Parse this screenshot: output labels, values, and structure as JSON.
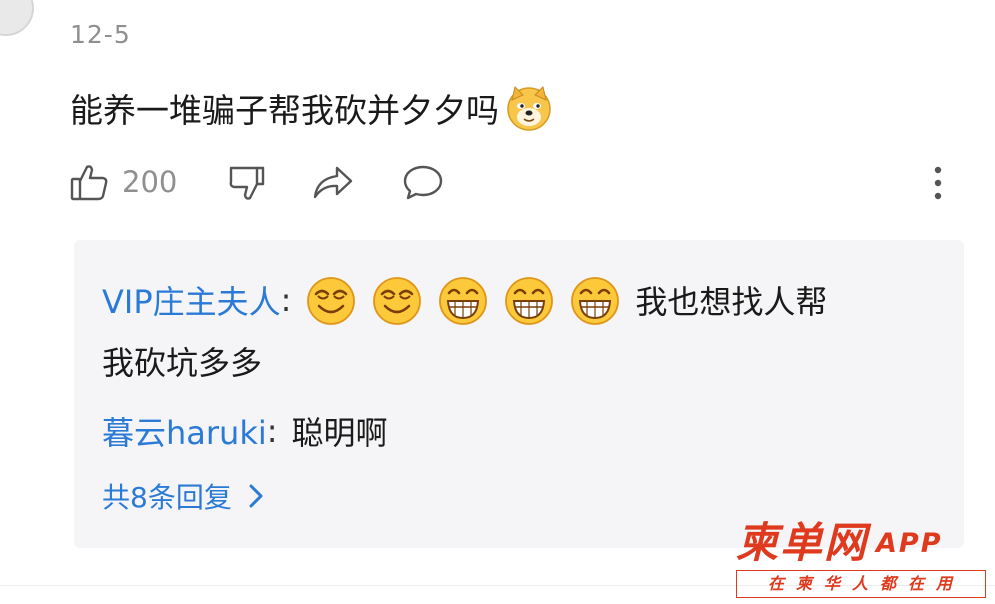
{
  "comment": {
    "date": "12-5",
    "text": "能养一堆骗子帮我砍并夕夕吗",
    "emoji": "doge-emoji"
  },
  "actions": {
    "like_count": "200",
    "icons": [
      "thumbs-up-icon",
      "thumbs-down-icon",
      "share-icon",
      "comment-icon",
      "more-icon"
    ]
  },
  "replies": [
    {
      "user": "VIP庄主夫人",
      "separator": ":",
      "emojis": [
        "smirk-emoji",
        "smirk-emoji",
        "grin-emoji",
        "grin-emoji",
        "grin-emoji"
      ],
      "text_line1": "我也想找人帮",
      "text_line2": "我砍坑多多"
    },
    {
      "user": "暮云haruki",
      "separator": ":",
      "text": "聪明啊"
    }
  ],
  "more_replies_label": "共8条回复",
  "watermark": {
    "logo": "柬单网",
    "app": "APP",
    "slogan": "在柬华人都在用"
  },
  "colors": {
    "link_blue": "#2b7bd6",
    "gray_text": "#8f8f8f",
    "reply_bg": "#f5f5f7",
    "watermark_red": "#e03a1e"
  }
}
